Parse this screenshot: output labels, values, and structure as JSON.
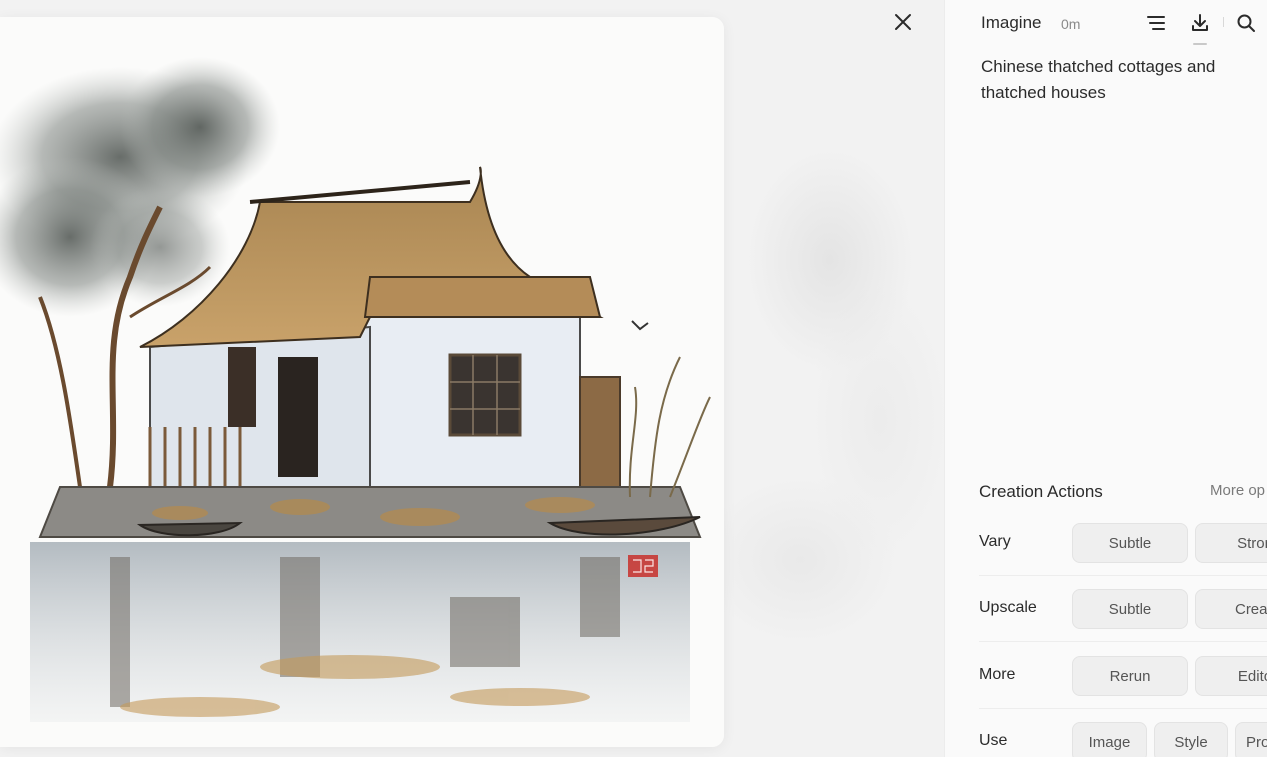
{
  "header": {
    "title": "Imagine",
    "time": "0m"
  },
  "prompt": "Chinese thatched cottages and thatched houses",
  "creation_actions": {
    "title": "Creation Actions",
    "more_options": "More op",
    "rows": [
      {
        "label": "Vary",
        "chips": [
          "Subtle",
          "Stron"
        ]
      },
      {
        "label": "Upscale",
        "chips": [
          "Subtle",
          "Creati"
        ]
      },
      {
        "label": "More",
        "chips": [
          "Rerun",
          "Edito"
        ]
      },
      {
        "label": "Use",
        "chips": [
          "Image",
          "Style",
          "Pro"
        ]
      }
    ]
  },
  "icons": {
    "close": "close-icon",
    "options": "options-icon",
    "download": "download-icon",
    "search": "search-icon"
  },
  "colors": {
    "panel_bg": "#fafafa",
    "chip_bg": "#efefef",
    "seal_red": "#c8302c"
  }
}
